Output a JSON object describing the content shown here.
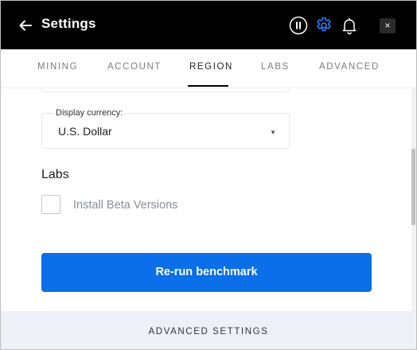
{
  "header": {
    "title": "Settings",
    "icons": [
      "back-arrow-icon",
      "pause-icon",
      "gear-icon",
      "bell-icon",
      "close-icon"
    ],
    "close_glyph": "×",
    "accent_color": "#0a6fe8"
  },
  "tabs": [
    {
      "label": "MINING",
      "active": false
    },
    {
      "label": "ACCOUNT",
      "active": false
    },
    {
      "label": "REGION",
      "active": true
    },
    {
      "label": "LABS",
      "active": false
    },
    {
      "label": "ADVANCED",
      "active": false
    }
  ],
  "region": {
    "currency_label": "Display currency:",
    "currency_value": "U.S. Dollar"
  },
  "labs": {
    "heading": "Labs",
    "beta_label": "Install Beta Versions",
    "beta_checked": false
  },
  "actions": {
    "rerun_label": "Re-run benchmark",
    "button_color": "#0a6fe8"
  },
  "footer": {
    "label": "ADVANCED SETTINGS"
  }
}
